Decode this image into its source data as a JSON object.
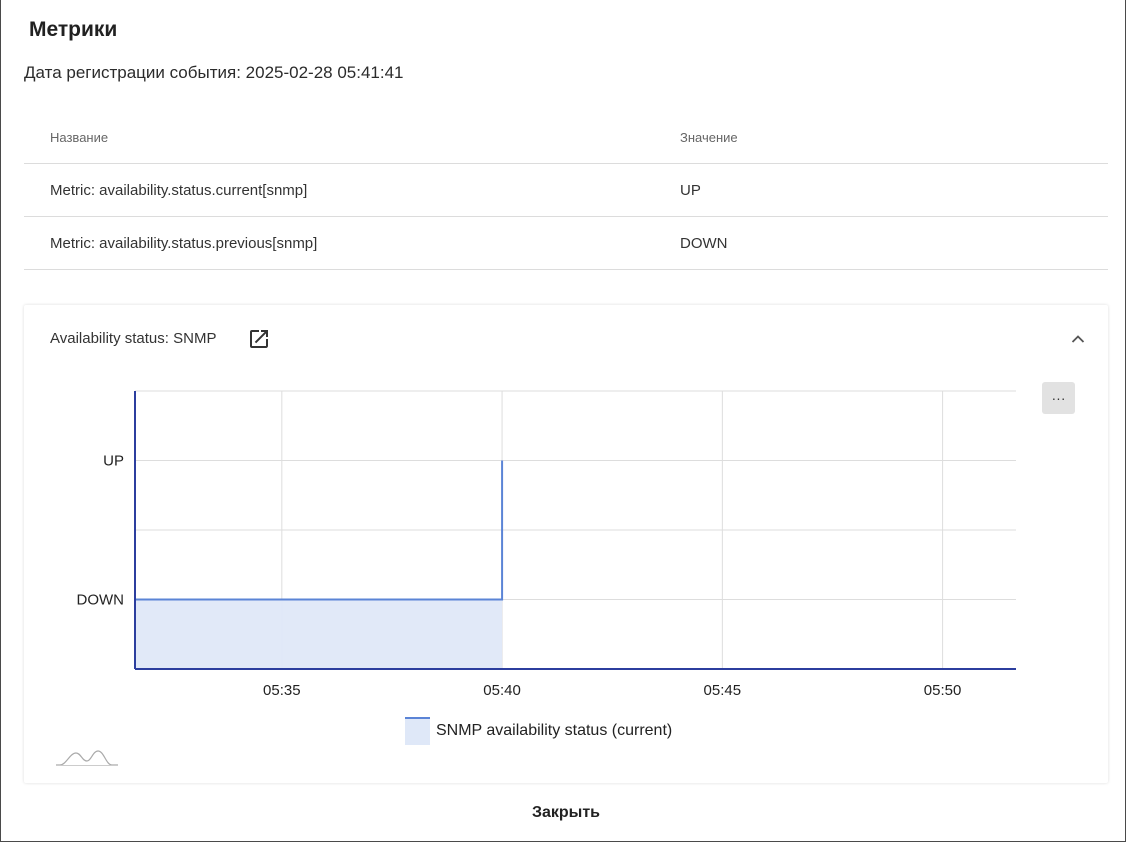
{
  "dialog": {
    "title": "Метрики",
    "registration_label": "Дата регистрации события: 2025-02-28 05:41:41",
    "close_label": "Закрыть"
  },
  "table": {
    "headers": [
      "Название",
      "Значение"
    ],
    "rows": [
      [
        "Metric: availability.status.current[snmp]",
        "UP"
      ],
      [
        "Metric: availability.status.previous[snmp]",
        "DOWN"
      ]
    ]
  },
  "panel": {
    "title": "Availability status: SNMP",
    "more_label": "···",
    "icons": {
      "open_external": "open-in-new-icon",
      "collapse": "chevron-up-icon",
      "wave": "wave-icon"
    }
  },
  "chart_data": {
    "type": "area",
    "x_ticks": [
      "05:35",
      "05:40",
      "05:45",
      "05:50"
    ],
    "y_ticks": [
      "UP",
      "DOWN"
    ],
    "xlim": [
      "05:31:40",
      "05:51:40"
    ],
    "series": [
      {
        "name": "SNMP availability status (current)",
        "points": [
          {
            "x": "05:31:40",
            "y": "DOWN"
          },
          {
            "x": "05:40:00",
            "y": "DOWN"
          },
          {
            "x": "05:40:00",
            "y": "UP"
          }
        ]
      }
    ],
    "grid": true,
    "legend": "bottom-center",
    "colors": {
      "line": "#5b84d6",
      "fill": "#dfe8f8",
      "axis": "#2c3e9e",
      "grid": "#dddddd"
    }
  }
}
